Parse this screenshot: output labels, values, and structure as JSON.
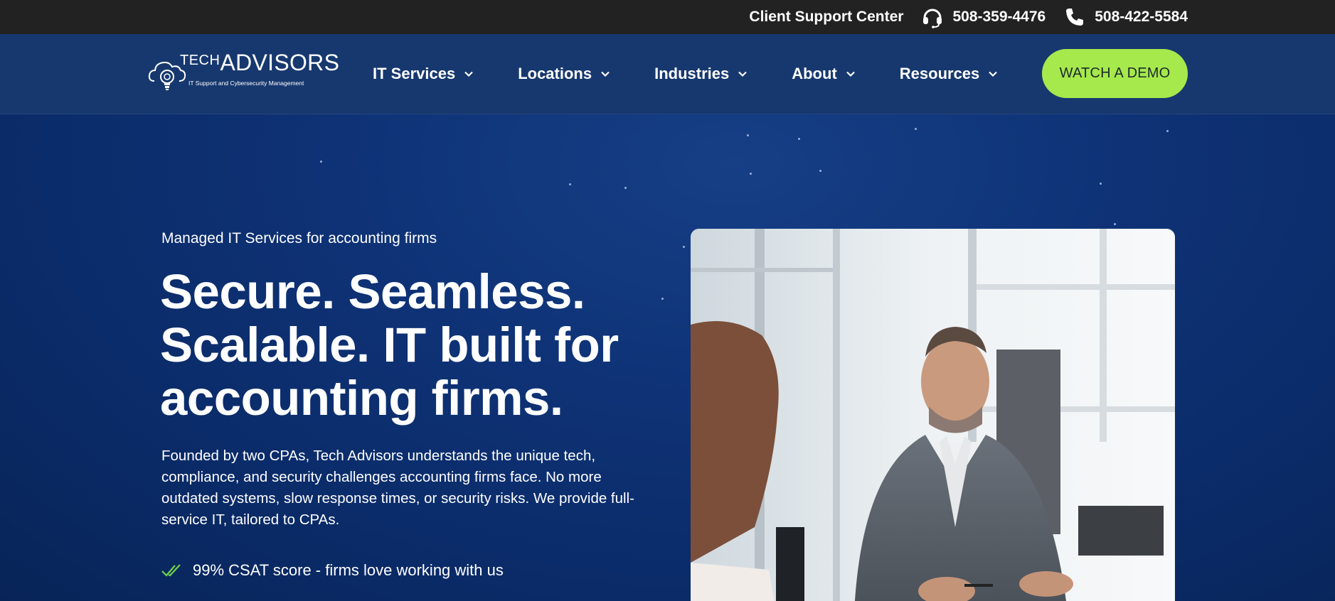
{
  "topbar": {
    "support_label": "Client Support Center",
    "phone_support": "508-359-4476",
    "phone_main": "508-422-5584",
    "support_icon": "headset-icon",
    "phone_icon": "phone-icon"
  },
  "logo": {
    "brand_prefix": "TECH",
    "brand_main": "ADVISORS",
    "tagline": "IT Support and Cybersecurity Management"
  },
  "nav": {
    "items": [
      {
        "label": "IT Services"
      },
      {
        "label": "Locations"
      },
      {
        "label": "Industries"
      },
      {
        "label": "About"
      },
      {
        "label": "Resources"
      }
    ],
    "cta_label": "WATCH A DEMO"
  },
  "hero": {
    "eyebrow": "Managed IT Services for accounting firms",
    "headline": "Secure. Seamless. Scalable. IT built for accounting firms.",
    "body": "Founded by two CPAs, Tech Advisors understands the unique tech, compliance, and security challenges accounting firms face. No more outdated systems, slow response times, or security risks. We provide full-service IT, tailored to CPAs.",
    "checks": [
      {
        "text": "99% CSAT score - firms love working with us"
      }
    ]
  },
  "colors": {
    "topbar_bg": "#222222",
    "nav_bg": "#17386f",
    "hero_bg": "#0b2e6e",
    "cta_bg": "#a6e94c",
    "check_green": "#6fd44a"
  }
}
